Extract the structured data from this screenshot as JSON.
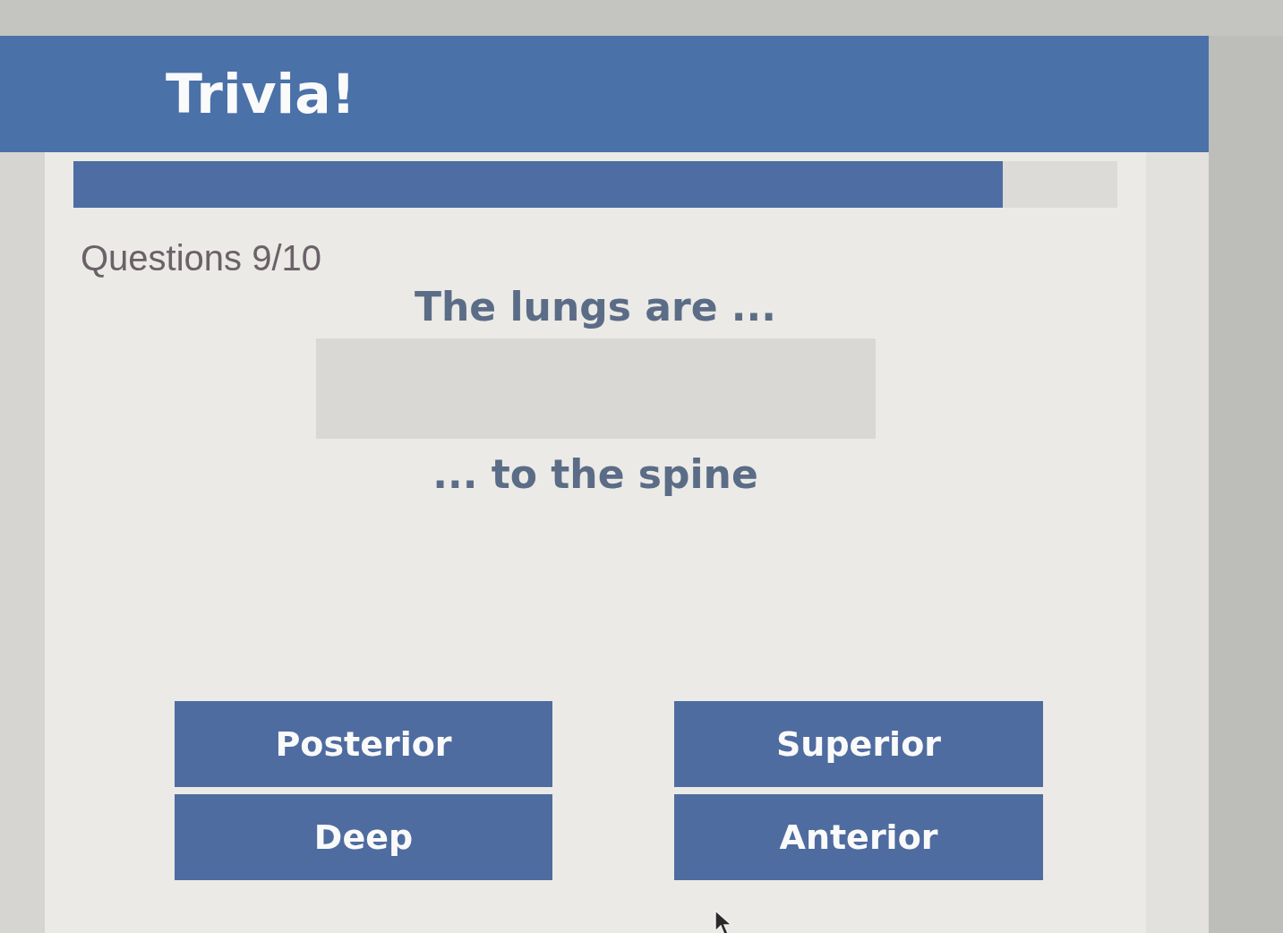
{
  "header": {
    "title": "Trivia!"
  },
  "progress": {
    "level": 0.89,
    "label": "Questions 9/10"
  },
  "question": {
    "prompt": "The lungs are ...",
    "suffix": "... to the spine"
  },
  "answers": [
    {
      "label": "Posterior"
    },
    {
      "label": "Superior"
    },
    {
      "label": "Deep"
    },
    {
      "label": "Anterior"
    }
  ]
}
